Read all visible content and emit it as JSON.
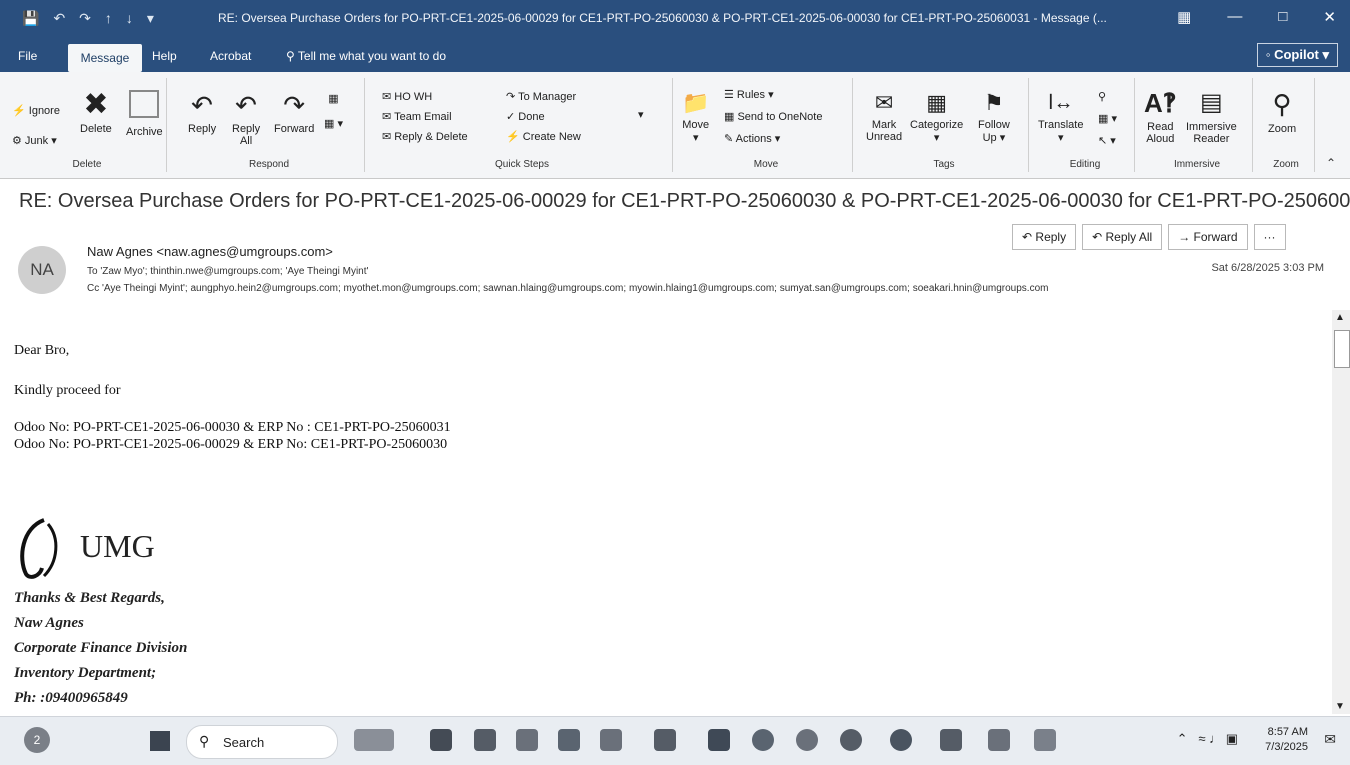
{
  "window": {
    "title": "RE: Oversea Purchase Orders for PO-PRT-CE1-2025-06-00029 for CE1-PRT-PO-25060030 & PO-PRT-CE1-2025-06-00030 for CE1-PRT-PO-25060031  -  Message (...",
    "qat_icons": [
      "save-icon",
      "undo-icon",
      "redo-icon",
      "up-icon",
      "down-icon",
      "more-icon"
    ]
  },
  "menu": {
    "file": "File",
    "message": "Message",
    "help": "Help",
    "acrobat": "Acrobat",
    "tell_me": "Tell me what you want to do",
    "copilot": "Copilot"
  },
  "ribbon": {
    "delete": {
      "ignore": "Ignore",
      "junk": "Junk",
      "delete": "Delete",
      "archive": "Archive",
      "label": "Delete"
    },
    "respond": {
      "reply": "Reply",
      "reply_all_1": "Reply",
      "reply_all_2": "All",
      "forward": "Forward",
      "label": "Respond"
    },
    "quick_steps": {
      "ho_wh": "HO WH",
      "team_email": "Team Email",
      "reply_delete": "Reply & Delete",
      "to_manager": "To Manager",
      "done": "Done",
      "create_new": "Create New",
      "label": "Quick Steps"
    },
    "move": {
      "move": "Move",
      "rules": "Rules",
      "onenote": "Send to OneNote",
      "actions": "Actions",
      "label": "Move"
    },
    "tags": {
      "mark_1": "Mark",
      "mark_2": "Unread",
      "categorize": "Categorize",
      "follow_1": "Follow",
      "follow_2": "Up",
      "label": "Tags"
    },
    "editing": {
      "translate": "Translate",
      "label": "Editing"
    },
    "immersive": {
      "read_1": "Read",
      "read_2": "Aloud",
      "imm_1": "Immersive",
      "imm_2": "Reader",
      "label": "Immersive"
    },
    "zoom": {
      "zoom": "Zoom",
      "label": "Zoom"
    }
  },
  "email": {
    "subject": "RE: Oversea Purchase Orders for PO-PRT-CE1-2025-06-00029 for CE1-PRT-PO-25060030 & PO-PRT-CE1-2025-06-00030 for CE1-PRT-PO-25060031",
    "avatar": "NA",
    "sender": "Naw Agnes <naw.agnes@umgroups.com>",
    "to": "To  'Zaw Myo'; thinthin.nwe@umgroups.com; 'Aye Theingi Myint'",
    "cc": "Cc  'Aye Theingi Myint'; aungphyo.hein2@umgroups.com; myothet.mon@umgroups.com; sawnan.hlaing@umgroups.com; myowin.hlaing1@umgroups.com; sumyat.san@umgroups.com; soeakari.hnin@umgroups.com",
    "date": "Sat 6/28/2025 3:03 PM",
    "actions": {
      "reply": "Reply",
      "reply_all": "Reply All",
      "forward": "Forward",
      "more": "···"
    },
    "body": {
      "greeting": "Dear Bro,",
      "line1": "Kindly proceed for",
      "line2": "Odoo No: PO-PRT-CE1-2025-06-00030 & ERP No : CE1-PRT-PO-25060031",
      "line3": "Odoo No: PO-PRT-CE1-2025-06-00029 & ERP No: CE1-PRT-PO-25060030"
    },
    "logo_text": "UMG",
    "signature": {
      "s1": "Thanks & Best Regards,",
      "s2": "Naw Agnes",
      "s3": "Corporate Finance Division",
      "s4": "Inventory Department;",
      "s5": "Ph:  :09400965849"
    }
  },
  "taskbar": {
    "search": "Search",
    "time": "8:57 AM",
    "date": "7/3/2025",
    "notification_count": "2"
  }
}
